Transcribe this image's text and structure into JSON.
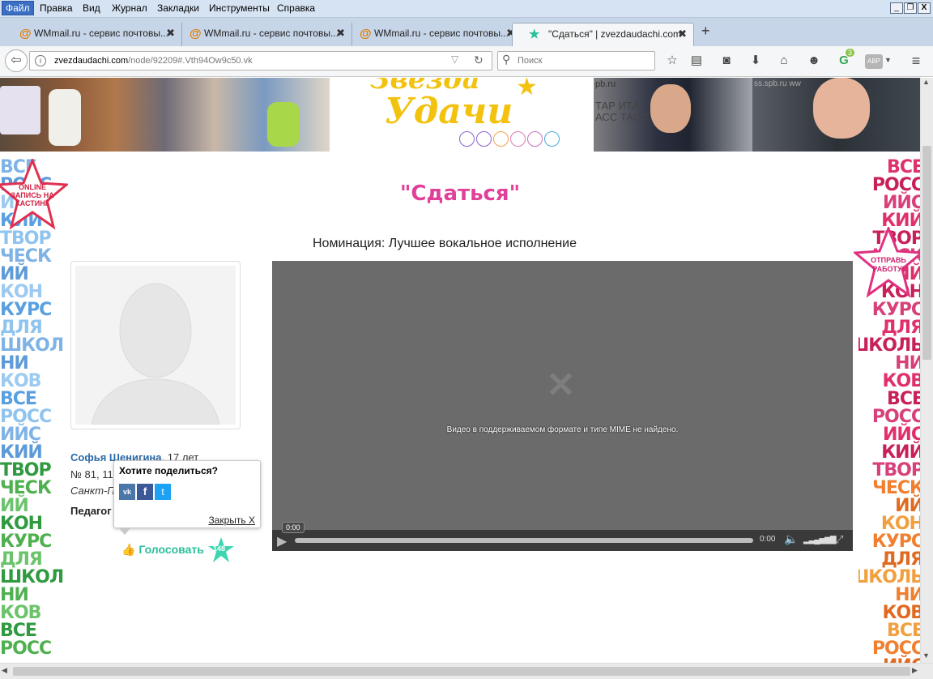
{
  "menu": {
    "items": [
      "Файл",
      "Правка",
      "Вид",
      "Журнал",
      "Закладки",
      "Инструменты",
      "Справка"
    ]
  },
  "window": {
    "minimize": "_",
    "restore": "❐",
    "close": "X"
  },
  "tabs": [
    {
      "title": "WMmail.ru - сервис почтовы...",
      "icon": "@"
    },
    {
      "title": "WMmail.ru - сервис почтовы...",
      "icon": "@"
    },
    {
      "title": "WMmail.ru - сервис почтовы...",
      "icon": "@"
    },
    {
      "title": "\"Сдаться\" | zvezdaudachi.com",
      "icon": "★",
      "active": true
    }
  ],
  "new_tab": "+",
  "nav": {
    "url_domain": "zvezdaudachi.com",
    "url_path": "/node/92209#.Vth94Ow9c50.vk",
    "search_placeholder": "Поиск",
    "badge_count": "3",
    "abbr": "ABP"
  },
  "banner": {
    "logo_text": "Удачи",
    "logo_top": "Звезда",
    "photo_caption_1": "pb.ru",
    "photo_caption_2": "ТАР ИТА\nАСС ТАСС",
    "photo_caption_3": "ss.spb.ru ww"
  },
  "page": {
    "title": "\"Сдаться\"",
    "nomination": "Номинация: Лучшее вокальное исполнение",
    "author_name": "Софья Шенигина",
    "author_age": ", 17 лет",
    "author_school": "№ 81, 11",
    "author_city": "Санкт-П",
    "author_teacher": "Педагог"
  },
  "share": {
    "title": "Хотите поделиться?",
    "close": "Закрыть X"
  },
  "vote": {
    "label": "Голосовать",
    "count": "148"
  },
  "video": {
    "error": "Видео в поддерживаемом формате и типе MIME не найдено.",
    "time_tooltip": "0:00",
    "time": "0:00"
  },
  "side_badges": {
    "left_line1": "ONLINE",
    "left_line2": "ЗАПИСЬ НА",
    "left_line3": "КАСТИНГ",
    "right_line1": "ОТПРАВЬ",
    "right_line2": "РАБОТУ!"
  },
  "deco_left": [
    "ВСЕ",
    "РОСС",
    "ИЙС",
    "КИЙ",
    "ТВОР",
    "ЧЕСК",
    "ИЙ",
    "КОН",
    "КУРС",
    "ДЛЯ",
    "ШКОЛЬ",
    "НИ",
    "КОВ",
    "ВСЕ",
    "РОСС",
    "ИЙС",
    "КИЙ",
    "ТВОР",
    "ЧЕСК",
    "ИЙ",
    "КОН",
    "КУРС",
    "ДЛЯ",
    "ШКОЛЬ",
    "НИ",
    "КОВ",
    "ВСЕ",
    "РОСС"
  ],
  "deco_right": [
    "ВСЕ",
    "РОСС",
    "ИЙС",
    "КИЙ",
    "ТВОР",
    "ЧЕСК",
    "ИЙ",
    "КОН",
    "КУРС",
    "ДЛЯ",
    "ШКОЛЬ",
    "НИ",
    "КОВ",
    "ВСЕ",
    "РОСС",
    "ИЙС",
    "КИЙ",
    "ТВОР",
    "ЧЕСК",
    "ИЙ",
    "КОН",
    "КУРС",
    "ДЛЯ",
    "ШКОЛЬ",
    "НИ",
    "КОВ",
    "ВСЕ",
    "РОСС",
    "ИЙС"
  ],
  "colors": {
    "title_pink": "#e0409a",
    "author_blue": "#2b6aa8",
    "vote_green": "#2bbf9a",
    "video_bg": "#6b6b6b",
    "logo_yellow": "#f3c20f"
  }
}
